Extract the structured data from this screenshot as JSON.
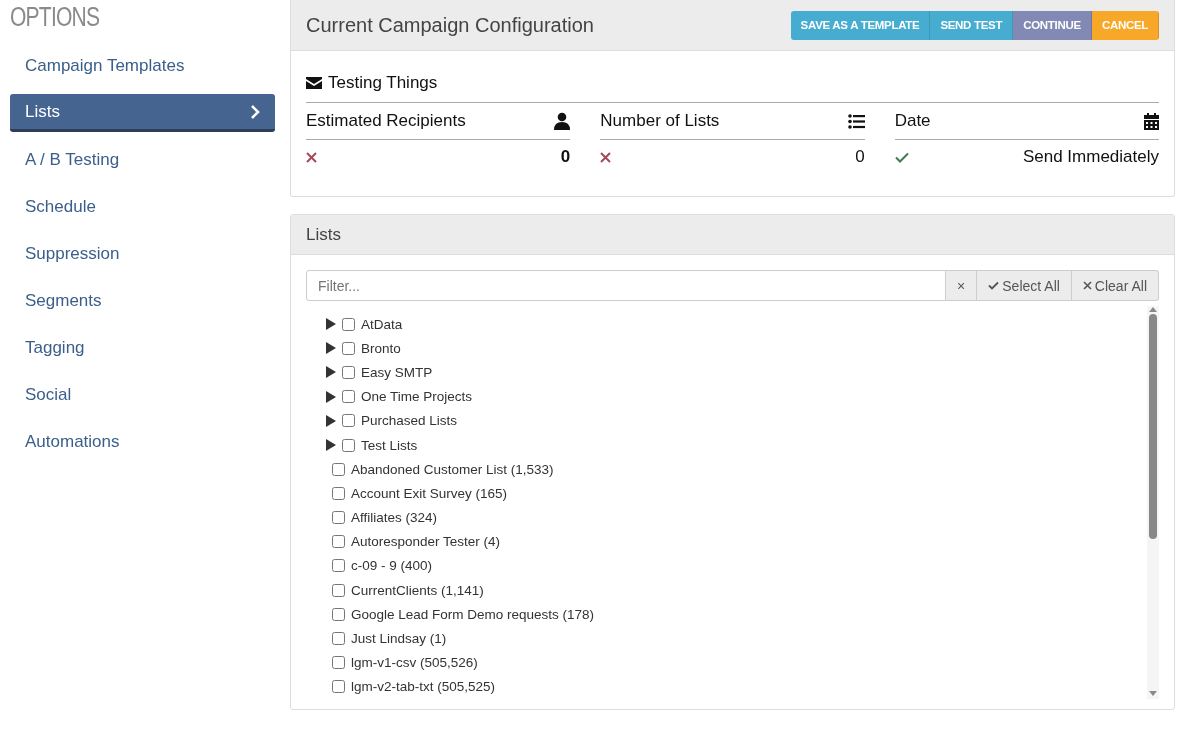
{
  "sidebar": {
    "title": "OPTIONS",
    "items": [
      {
        "label": "Campaign Templates",
        "selected": false
      },
      {
        "label": "Lists",
        "selected": true
      },
      {
        "label": "A / B Testing",
        "selected": false
      },
      {
        "label": "Schedule",
        "selected": false
      },
      {
        "label": "Suppression",
        "selected": false
      },
      {
        "label": "Segments",
        "selected": false
      },
      {
        "label": "Tagging",
        "selected": false
      },
      {
        "label": "Social",
        "selected": false
      },
      {
        "label": "Automations",
        "selected": false
      }
    ]
  },
  "config": {
    "title": "Current Campaign Configuration",
    "buttons": [
      {
        "label": "SAVE AS A TEMPLATE",
        "color": "#46add0"
      },
      {
        "label": "SEND TEST",
        "color": "#46add0"
      },
      {
        "label": "CONTINUE",
        "color": "#8189b4"
      },
      {
        "label": "CANCEL",
        "color": "#f8a829"
      }
    ],
    "campaign_name": "Testing Things",
    "stats": [
      {
        "label": "Estimated Recipients",
        "passed": false,
        "value": "0",
        "bold": true
      },
      {
        "label": "Number of Lists",
        "passed": false,
        "value": "0",
        "bold": false
      },
      {
        "label": "Date",
        "passed": true,
        "value": "Send Immediately",
        "bold": false
      }
    ]
  },
  "lists": {
    "title": "Lists",
    "filter": {
      "placeholder": "Filter..."
    },
    "clear_button": "×",
    "select_all": "Select All",
    "clear_all": "Clear All",
    "items": [
      {
        "kind": "group",
        "label": "AtData",
        "checked": false,
        "expanded": false
      },
      {
        "kind": "group",
        "label": "Bronto",
        "checked": false,
        "expanded": false
      },
      {
        "kind": "group",
        "label": "Easy SMTP",
        "checked": false,
        "expanded": false
      },
      {
        "kind": "group",
        "label": "One Time Projects",
        "checked": false,
        "expanded": false
      },
      {
        "kind": "group",
        "label": "Purchased Lists",
        "checked": false,
        "expanded": false
      },
      {
        "kind": "group",
        "label": "Test Lists",
        "checked": false,
        "expanded": false
      },
      {
        "kind": "list",
        "label": "Abandoned Customer List (1,533)",
        "checked": false
      },
      {
        "kind": "list",
        "label": "Account Exit Survey (165)",
        "checked": false
      },
      {
        "kind": "list",
        "label": "Affiliates (324)",
        "checked": false
      },
      {
        "kind": "list",
        "label": "Autoresponder Tester (4)",
        "checked": false
      },
      {
        "kind": "list",
        "label": "c-09 - 9 (400)",
        "checked": false
      },
      {
        "kind": "list",
        "label": "CurrentClients (1,141)",
        "checked": false
      },
      {
        "kind": "list",
        "label": "Google Lead Form Demo requests (178)",
        "checked": false
      },
      {
        "kind": "list",
        "label": "Just Lindsay (1)",
        "checked": false
      },
      {
        "kind": "list",
        "label": "lgm-v1-csv (505,526)",
        "checked": false
      },
      {
        "kind": "list",
        "label": "lgm-v2-tab-txt (505,525)",
        "checked": false
      }
    ]
  }
}
